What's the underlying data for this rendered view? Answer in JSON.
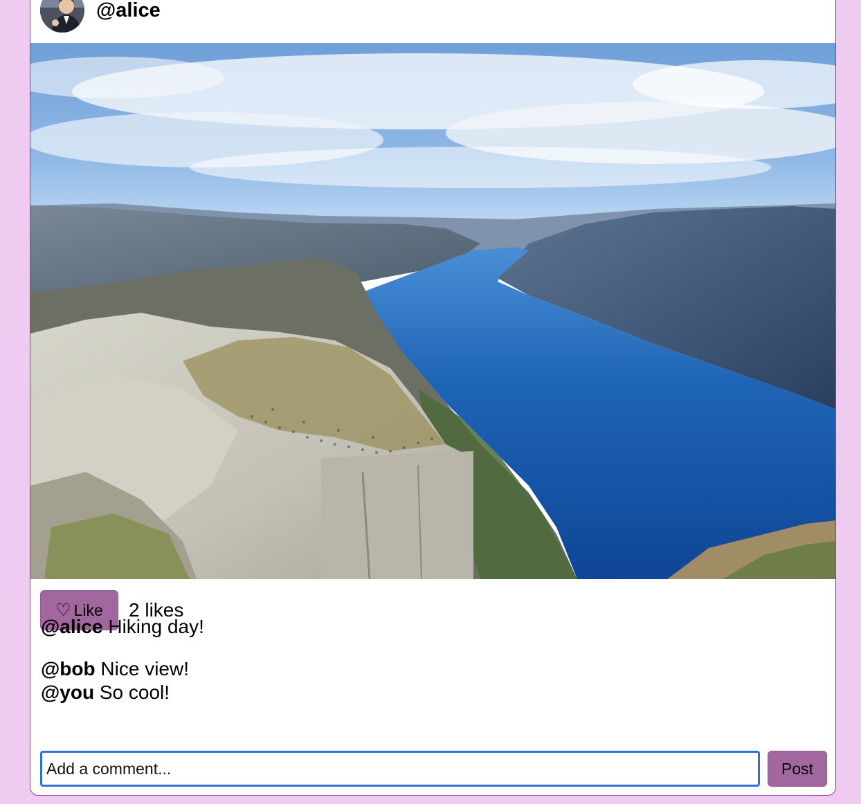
{
  "post": {
    "author": "@alice",
    "avatar_icon": "user-avatar-photo",
    "image_description_icon": "fjord-cliff-photo"
  },
  "actions": {
    "like_icon": "♡",
    "like_label": "Like",
    "likes_text": "2 likes"
  },
  "caption": {
    "author": "@alice",
    "text": " Hiking day!"
  },
  "comments": [
    {
      "author": "@bob",
      "text": " Nice view!"
    },
    {
      "author": "@you",
      "text": " So cool!"
    }
  ],
  "comment_form": {
    "placeholder": "Add a comment...",
    "value": "",
    "submit_label": "Post"
  },
  "colors": {
    "page_background": "#efcbf2",
    "button": "#a2679f",
    "card_border": "#8e3f97",
    "input_focus": "#2f6fd6"
  }
}
